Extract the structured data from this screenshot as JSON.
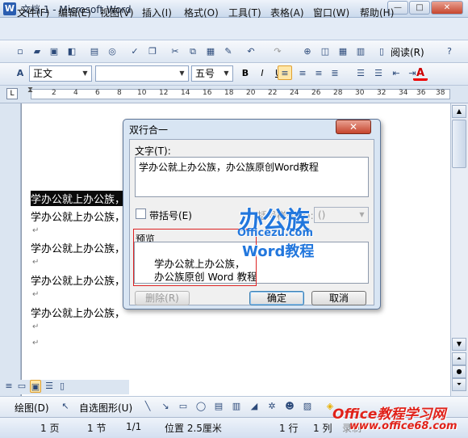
{
  "window": {
    "title": "文档 1 - Microsoft Word",
    "app_icon": "W",
    "min": "—",
    "max": "□",
    "close": "✕"
  },
  "menu": [
    "文件(F)",
    "编辑(E)",
    "视图(V)",
    "插入(I)",
    "格式(O)",
    "工具(T)",
    "表格(A)",
    "窗口(W)",
    "帮助(H)"
  ],
  "toolbar": {
    "reading_label": "阅读(R)"
  },
  "format": {
    "style_value": "正文",
    "font_value": "",
    "size_value": "五号",
    "bold": "B",
    "italic": "I",
    "underline": "U",
    "font_color_letter": "A"
  },
  "ruler_numbers": [
    "2",
    "4",
    "6",
    "8",
    "10",
    "12",
    "14",
    "16",
    "18",
    "20",
    "22",
    "24",
    "26",
    "28",
    "30",
    "32",
    "34",
    "36",
    "38"
  ],
  "document": {
    "lines": [
      "学办公就上办公族，",
      "学办公就上办公族，",
      "学办公就上办公族，",
      "学办公就上办公族，",
      "学办公就上办公族，"
    ],
    "para_mark": "↵"
  },
  "dialog": {
    "title": "双行合一",
    "close": "✕",
    "text_label": "文字(T):",
    "text_value": "学办公就上办公族，办公族原创Word教程",
    "bracket_label": "带括号(E)",
    "bracket_type_label": "括号样式(B):",
    "bracket_value": "()",
    "preview_label": "预览",
    "preview_line1": "学办公就上办公族，",
    "preview_line2": "办公族原创 Word 教程",
    "delete_button": "删除(R)",
    "ok_button": "确定",
    "cancel_button": "取消"
  },
  "logo": {
    "cn": "办公族",
    "url": "Officezu.com",
    "word": "Word教程"
  },
  "drawbar": {
    "draw_label": "绘图(D)",
    "autoshape_label": "自选图形(U)"
  },
  "status": {
    "page": "1 页",
    "section": "1 节",
    "pages": "1/1",
    "position": "位置 2.5厘米",
    "line": "1 行",
    "col": "1 列",
    "rec": "录制"
  },
  "watermark": {
    "line1": "Office教程学习网",
    "line2": "www.office68.com"
  },
  "colors": {
    "accent": "#2a5db0",
    "selection": "#0a0a0a",
    "dialog_close": "#c6452d",
    "preview_frame": "#dd2222",
    "logo": "#2277dd",
    "watermark": "#e0221a"
  }
}
